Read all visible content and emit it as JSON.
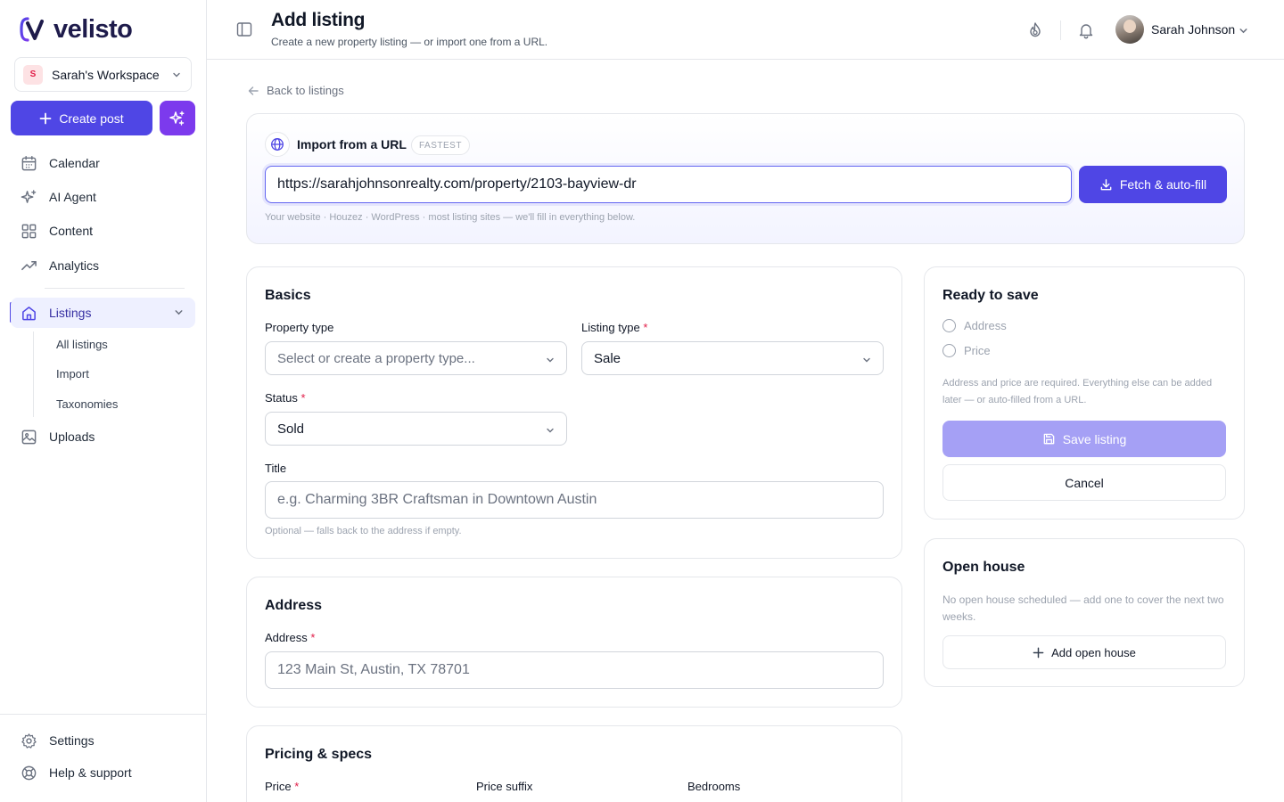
{
  "app": {
    "logo_text": "velisto",
    "brand_color": "#4f46e5"
  },
  "sidebar": {
    "workspace": {
      "initial": "S",
      "name": "Sarah's Workspace"
    },
    "create_post_label": "Create post",
    "nav": [
      {
        "label": "Calendar",
        "icon": "calendar-icon"
      },
      {
        "label": "AI Agent",
        "icon": "sparkles-icon"
      },
      {
        "label": "Content",
        "icon": "grid-icon"
      },
      {
        "label": "Analytics",
        "icon": "trend-icon"
      },
      {
        "label": "Listings",
        "icon": "home-icon"
      },
      {
        "label": "Uploads",
        "icon": "image-icon"
      }
    ],
    "listings_sub": [
      "All listings",
      "Import",
      "Taxonomies"
    ],
    "bottom": [
      {
        "label": "Settings",
        "icon": "gear-icon"
      },
      {
        "label": "Help & support",
        "icon": "lifebuoy-icon"
      }
    ]
  },
  "header": {
    "title": "Add listing",
    "subtitle": "Create a new property listing — or import one from a URL.",
    "user_name": "Sarah Johnson"
  },
  "back_label": "Back to listings",
  "import": {
    "title": "Import from a URL",
    "badge": "FASTEST",
    "url_value": "https://sarahjohnsonrealty.com/property/2103-bayview-dr",
    "button_label": "Fetch & auto-fill",
    "hint": "Your website · Houzez · WordPress · most listing sites — we'll fill in everything below."
  },
  "basics": {
    "title": "Basics",
    "property_type_label": "Property type",
    "property_type_placeholder": "Select or create a property type...",
    "listing_type_label": "Listing type",
    "listing_type_value": "Sale",
    "status_label": "Status",
    "status_value": "Sold",
    "title_label": "Title",
    "title_placeholder": "e.g. Charming 3BR Craftsman in Downtown Austin",
    "title_help": "Optional — falls back to the address if empty."
  },
  "address": {
    "title": "Address",
    "label": "Address",
    "placeholder": "123 Main St, Austin, TX 78701"
  },
  "pricing": {
    "title": "Pricing & specs",
    "price_label": "Price",
    "price_suffix_label": "Price suffix",
    "bedrooms_label": "Bedrooms"
  },
  "ready": {
    "title": "Ready to save",
    "items": [
      "Address",
      "Price"
    ],
    "note": "Address and price are required. Everything else can be added later — or auto-filled from a URL.",
    "save_label": "Save listing",
    "cancel_label": "Cancel"
  },
  "open_house": {
    "title": "Open house",
    "note": "No open house scheduled — add one to cover the next two weeks.",
    "button_label": "Add open house"
  },
  "required_marker": "*"
}
